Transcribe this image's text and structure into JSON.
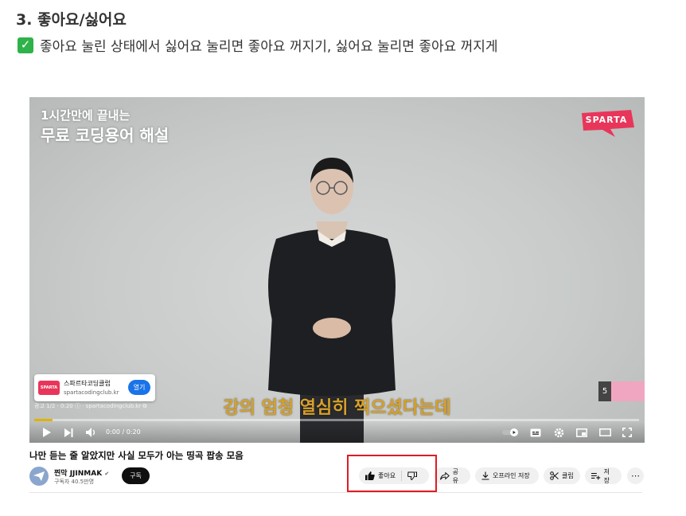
{
  "heading": "3. 좋아요/싫어요",
  "description": "좋아요 눌린 상태에서 싫어요 눌리면 좋아요 꺼지기, 싫어요 눌리면 좋아요 꺼지게",
  "video": {
    "overlay_small": "1시간만에 끝내는",
    "overlay_big": "무료 코딩용어 해설",
    "logo_text": "SPARTA",
    "subtitle": "강의 엄청 열심히 찍으셨다는데",
    "ad": {
      "logo_text": "SPARTA",
      "name": "스파르타코딩클럽",
      "url": "spartacodingclub.kr",
      "open": "열기",
      "info": "광고 1/2 · 0:20 ⓘ · spartacodingclub.kr ⧉"
    },
    "endcard_number": "5",
    "time": "0:00 / 0:20",
    "progress_fraction": 0.0
  },
  "video_title": "나만 듣는 줄 알았지만 사실 모두가 아는 띵곡 팝송 모음",
  "channel": {
    "name": "찐막 JJINMAK",
    "verified": "✔",
    "subscribers": "구독자 40.5만명",
    "subscribe_label": "구독"
  },
  "actions": {
    "like": "좋아요",
    "share": "공유",
    "download": "오프라인 저장",
    "clip": "클립",
    "save": "저장",
    "more": "⋯"
  },
  "colors": {
    "checkbox": "#2fb24a",
    "highlight": "#e01b24",
    "subtitle": "#d6a02a",
    "sparta": "#e8365a"
  }
}
